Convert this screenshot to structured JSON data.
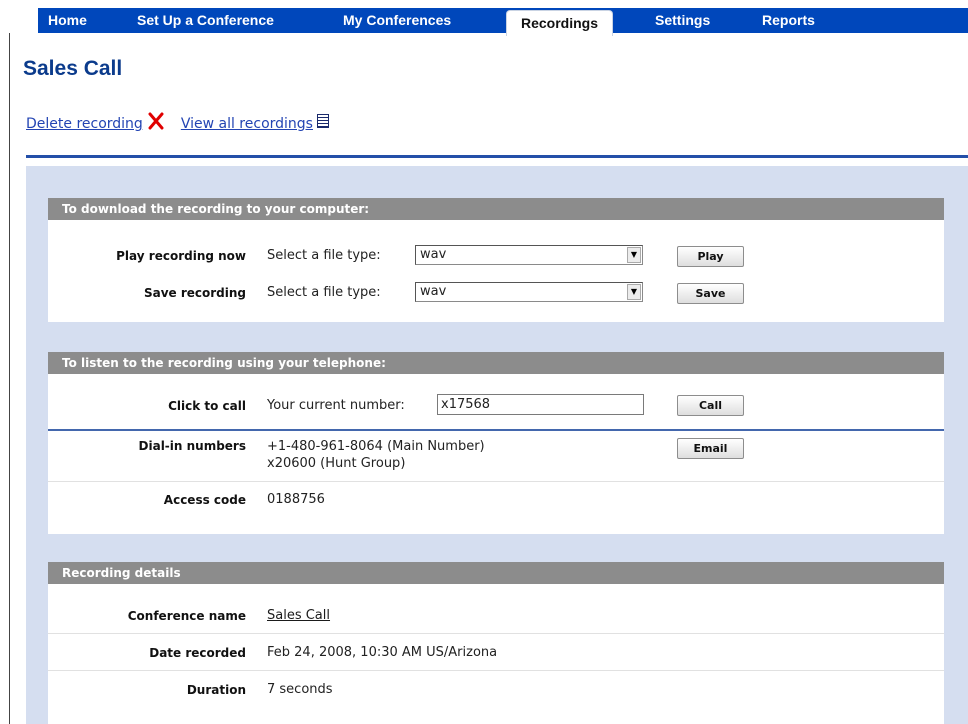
{
  "nav": {
    "items": [
      "Home",
      "Set Up a Conference",
      "My Conferences",
      "Recordings",
      "Settings",
      "Reports"
    ],
    "active": "Recordings"
  },
  "page": {
    "title": "Sales Call"
  },
  "actions": {
    "delete": "Delete recording",
    "view_all": "View all recordings"
  },
  "download": {
    "header": "To download the recording to your computer:",
    "play_label": "Play recording now",
    "save_label": "Save recording",
    "select_prompt": "Select a file type:",
    "play_file_type": "wav",
    "save_file_type": "wav",
    "play_button": "Play",
    "save_button": "Save"
  },
  "telephone": {
    "header": "To listen to the recording using your telephone:",
    "click_to_call_label": "Click to call",
    "current_number_prompt": "Your current number:",
    "current_number": "x17568",
    "call_button": "Call",
    "dial_in_label": "Dial-in numbers",
    "dial_in_main": "+1-480-961-8064 (Main Number)",
    "dial_in_hunt": "x20600 (Hunt Group)",
    "email_button": "Email",
    "access_code_label": "Access code",
    "access_code": "0188756"
  },
  "details": {
    "header": "Recording details",
    "conference_name_label": "Conference name",
    "conference_name": "Sales Call",
    "date_label": "Date recorded",
    "date": "Feb 24, 2008, 10:30 AM US/Arizona",
    "duration_label": "Duration",
    "duration": "7 seconds"
  },
  "icons": {
    "delete": "red-x-icon",
    "view_all": "list-icon",
    "dropdown": "chevron-down-icon"
  },
  "colors": {
    "nav": "#0047bb",
    "title": "#0b3b8c",
    "panel_header": "#8c8c8c",
    "content_bg": "#d5def0",
    "delete_icon": "#e00000"
  }
}
